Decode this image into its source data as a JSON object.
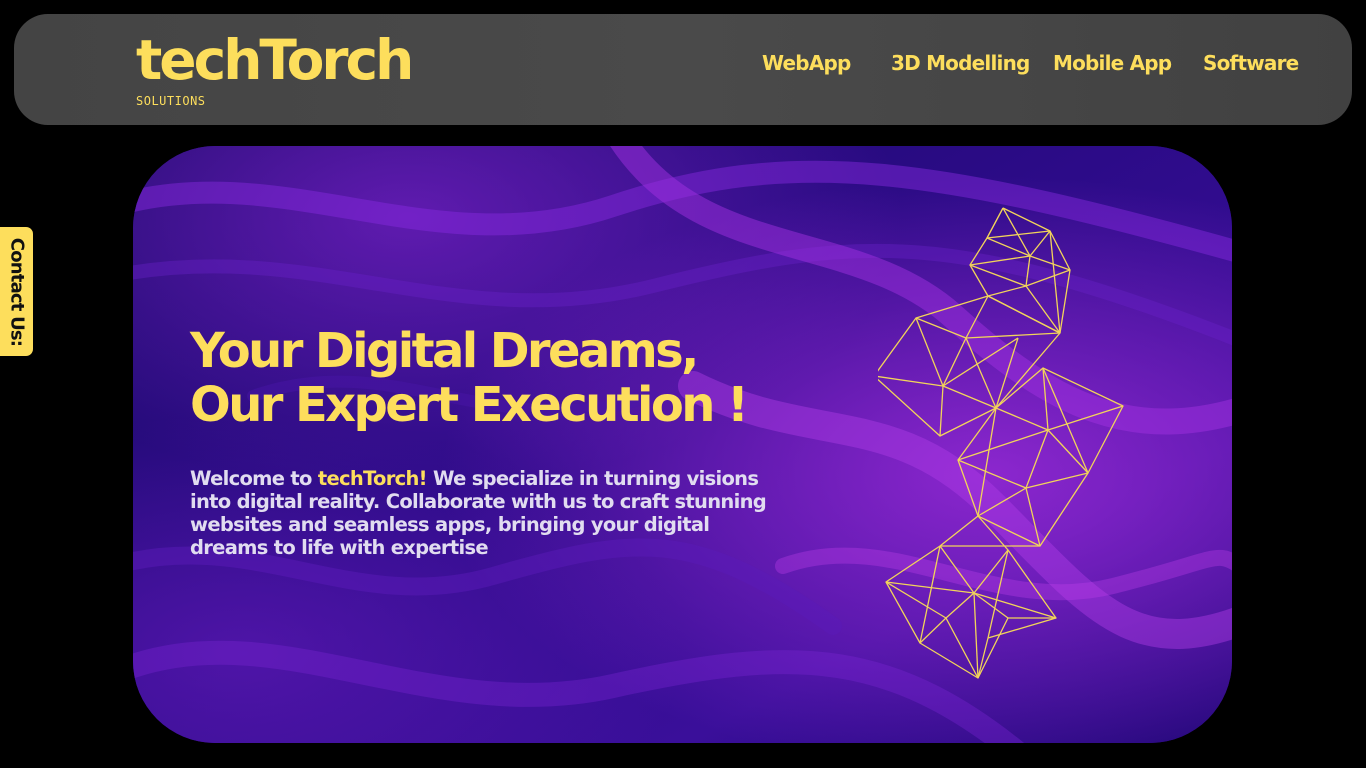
{
  "brand": {
    "name": "techTorch",
    "subtitle": "SOLUTIONS"
  },
  "nav": {
    "items": [
      {
        "label": "WebApp"
      },
      {
        "label": "3D Modelling"
      },
      {
        "label": "Mobile App"
      },
      {
        "label": "Software"
      }
    ]
  },
  "contact_tab": {
    "label": "Contact Us:"
  },
  "hero": {
    "title_line1": "Your Digital Dreams,",
    "title_line2": "Our Expert Execution !",
    "text_prefix": "Welcome to ",
    "text_highlight": "techTorch!",
    "text_rest": " We specialize in turning visions into digital reality. Collaborate with us to craft stunning websites and seamless apps, bringing your digital dreams to life with expertise",
    "graphic_icon": "low-poly-mesh-icon"
  },
  "colors": {
    "page_background": "#000000",
    "navbar_background": "#474747",
    "accent_yellow": "#FDDE5C",
    "hero_purple_dark": "#230a78",
    "hero_purple_light": "#8a2be2",
    "body_text": "#E1DCF0"
  }
}
